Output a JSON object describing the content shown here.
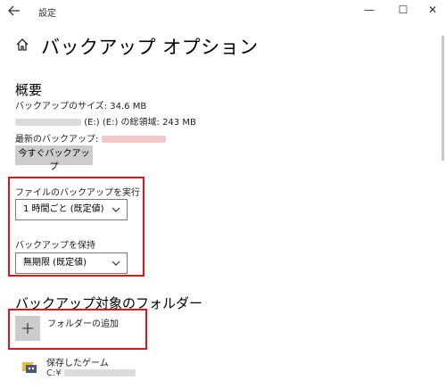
{
  "window": {
    "title": "設定",
    "minimize": "—",
    "maximize": "☐",
    "close": "✕"
  },
  "header": {
    "page_title": "バックアップ オプション"
  },
  "overview": {
    "heading": "概要",
    "backup_size_label": "バックアップのサイズ: 34.6 MB",
    "drive_line": "(E:) (E:) の総領域: 243 MB",
    "latest_backup_label": "最新のバックアップ:",
    "backup_now_button": "今すぐバックアップ"
  },
  "run_backup": {
    "label": "ファイルのバックアップを実行",
    "selected": "1 時間ごと (既定値)"
  },
  "keep_backup": {
    "label": "バックアップを保持",
    "selected": "無期限 (既定値)"
  },
  "folders": {
    "heading": "バックアップ対象のフォルダー",
    "add_folder_label": "フォルダーの追加",
    "items": [
      {
        "name": "保存したゲーム",
        "path_prefix": "C:¥"
      }
    ]
  },
  "colors": {
    "highlight_border": "#e0141e",
    "button_bg": "#cccccc",
    "add_tile_bg": "#cccccc"
  }
}
